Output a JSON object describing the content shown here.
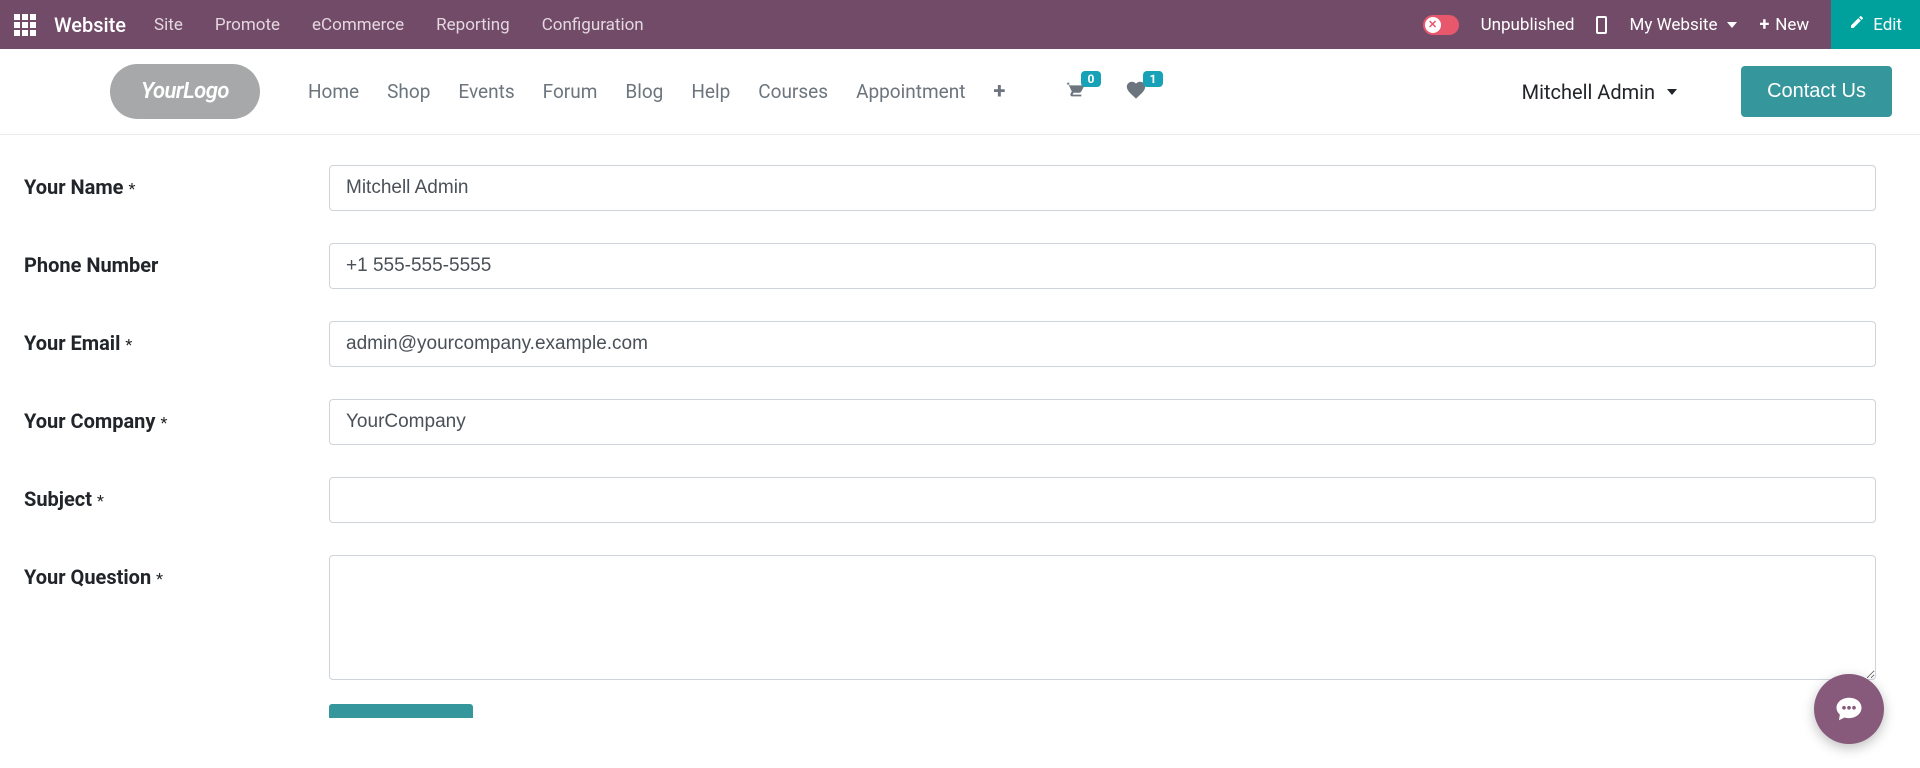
{
  "admin": {
    "brand": "Website",
    "menu": [
      "Site",
      "Promote",
      "eCommerce",
      "Reporting",
      "Configuration"
    ],
    "publish_status": "Unpublished",
    "website_selector": "My Website",
    "new_label": "New",
    "edit_label": "Edit"
  },
  "site_nav": {
    "logo_text": "YourLogo",
    "links": [
      "Home",
      "Shop",
      "Events",
      "Forum",
      "Blog",
      "Help",
      "Courses",
      "Appointment"
    ],
    "cart_count": "0",
    "wishlist_count": "1",
    "user_name": "Mitchell Admin",
    "contact_label": "Contact Us"
  },
  "form": {
    "fields": [
      {
        "label": "Your Name",
        "required": true,
        "value": "Mitchell Admin",
        "type": "text"
      },
      {
        "label": "Phone Number",
        "required": false,
        "value": "+1 555-555-5555",
        "type": "text"
      },
      {
        "label": "Your Email",
        "required": true,
        "value": "admin@yourcompany.example.com",
        "type": "text"
      },
      {
        "label": "Your Company",
        "required": true,
        "value": "YourCompany",
        "type": "text"
      },
      {
        "label": "Subject",
        "required": true,
        "value": "",
        "type": "text"
      },
      {
        "label": "Your Question",
        "required": true,
        "value": "",
        "type": "textarea"
      }
    ]
  }
}
